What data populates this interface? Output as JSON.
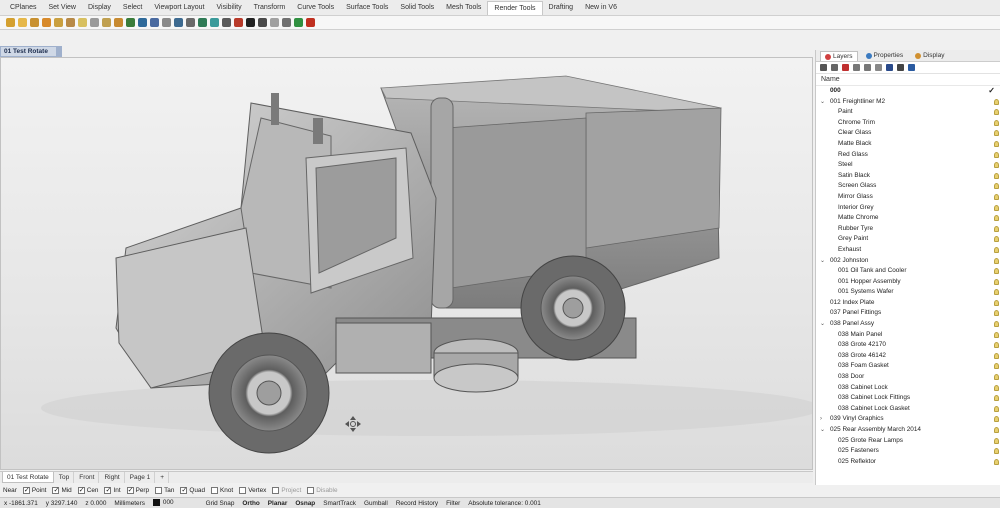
{
  "menu_tabs": [
    "CPlanes",
    "Set View",
    "Display",
    "Select",
    "Viewport Layout",
    "Visibility",
    "Transform",
    "Curve Tools",
    "Surface Tools",
    "Solid Tools",
    "Mesh Tools",
    "Render Tools",
    "Drafting",
    "New in V6"
  ],
  "active_menu_tab": "Render Tools",
  "viewport": {
    "title": "01 Test Rotate"
  },
  "panel": {
    "tabs": [
      "Layers",
      "Properties",
      "Display"
    ],
    "name_header": "Name",
    "layers": [
      {
        "label": "000",
        "indent": 1,
        "current": true
      },
      {
        "label": "001 Freightliner M2",
        "indent": 0,
        "expanded": true
      },
      {
        "label": "Paint",
        "indent": 2
      },
      {
        "label": "Chrome Trim",
        "indent": 2
      },
      {
        "label": "Clear Glass",
        "indent": 2
      },
      {
        "label": "Matte Black",
        "indent": 2
      },
      {
        "label": "Red Glass",
        "indent": 2
      },
      {
        "label": "Steel",
        "indent": 2
      },
      {
        "label": "Satin Black",
        "indent": 2
      },
      {
        "label": "Screen Glass",
        "indent": 2
      },
      {
        "label": "Mirror Glass",
        "indent": 2
      },
      {
        "label": "Interior Grey",
        "indent": 2
      },
      {
        "label": "Matte Chrome",
        "indent": 2
      },
      {
        "label": "Rubber Tyre",
        "indent": 2
      },
      {
        "label": "Grey Paint",
        "indent": 2
      },
      {
        "label": "Exhaust",
        "indent": 2
      },
      {
        "label": "002 Johnston",
        "indent": 0,
        "expanded": true
      },
      {
        "label": "001 Oil Tank and Cooler",
        "indent": 2
      },
      {
        "label": "001 Hopper Assembly",
        "indent": 2
      },
      {
        "label": "001 Systems Wafer",
        "indent": 2
      },
      {
        "label": "012 Index Plate",
        "indent": 1
      },
      {
        "label": "037 Panel Fittings",
        "indent": 1
      },
      {
        "label": "038 Panel Assy",
        "indent": 0,
        "expanded": true
      },
      {
        "label": "038 Main Panel",
        "indent": 2
      },
      {
        "label": "038 Grote 42170",
        "indent": 2
      },
      {
        "label": "038 Grote 46142",
        "indent": 2
      },
      {
        "label": "038 Foam Gasket",
        "indent": 2
      },
      {
        "label": "038 Door",
        "indent": 2
      },
      {
        "label": "038 Cabinet Lock",
        "indent": 2
      },
      {
        "label": "038 Cabinet Lock Fittings",
        "indent": 2
      },
      {
        "label": "038 Cabinet Lock Gasket",
        "indent": 2
      },
      {
        "label": "039 Vinyl Graphics",
        "indent": 0,
        "expanded": false
      },
      {
        "label": "025 Rear Assembly March 2014",
        "indent": 0,
        "expanded": true
      },
      {
        "label": "025 Grote Rear Lamps",
        "indent": 2
      },
      {
        "label": "025 Fasteners",
        "indent": 2
      },
      {
        "label": "025 Reflektor",
        "indent": 2
      }
    ]
  },
  "viewport_tabs": [
    "01 Test Rotate",
    "Top",
    "Front",
    "Right",
    "Page 1"
  ],
  "active_viewport_tab": "01 Test Rotate",
  "osnaps": [
    {
      "label": "Near",
      "checkbox": false
    },
    {
      "label": "Point",
      "checked": true
    },
    {
      "label": "Mid",
      "checked": true
    },
    {
      "label": "Cen",
      "checked": true
    },
    {
      "label": "Int",
      "checked": true
    },
    {
      "label": "Perp",
      "checked": true
    },
    {
      "label": "Tan",
      "checked": false
    },
    {
      "label": "Quad",
      "checked": true
    },
    {
      "label": "Knot",
      "checked": false
    },
    {
      "label": "Vertex",
      "checked": false
    },
    {
      "label": "Project",
      "checked": false,
      "disabled": true
    },
    {
      "label": "Disable",
      "checked": false,
      "disabled": true
    }
  ],
  "status": {
    "x": "x -1861.371",
    "y": "y 3297.140",
    "z": "z 0.000",
    "units": "Millimeters",
    "layer": "000",
    "toggles": [
      "Grid Snap",
      "Ortho",
      "Planar",
      "Osnap",
      "SmartTrack",
      "Gumball",
      "Record History",
      "Filter"
    ],
    "bold_toggles": [
      "Ortho",
      "Planar",
      "Osnap"
    ],
    "tolerance": "Absolute tolerance: 0.001"
  }
}
